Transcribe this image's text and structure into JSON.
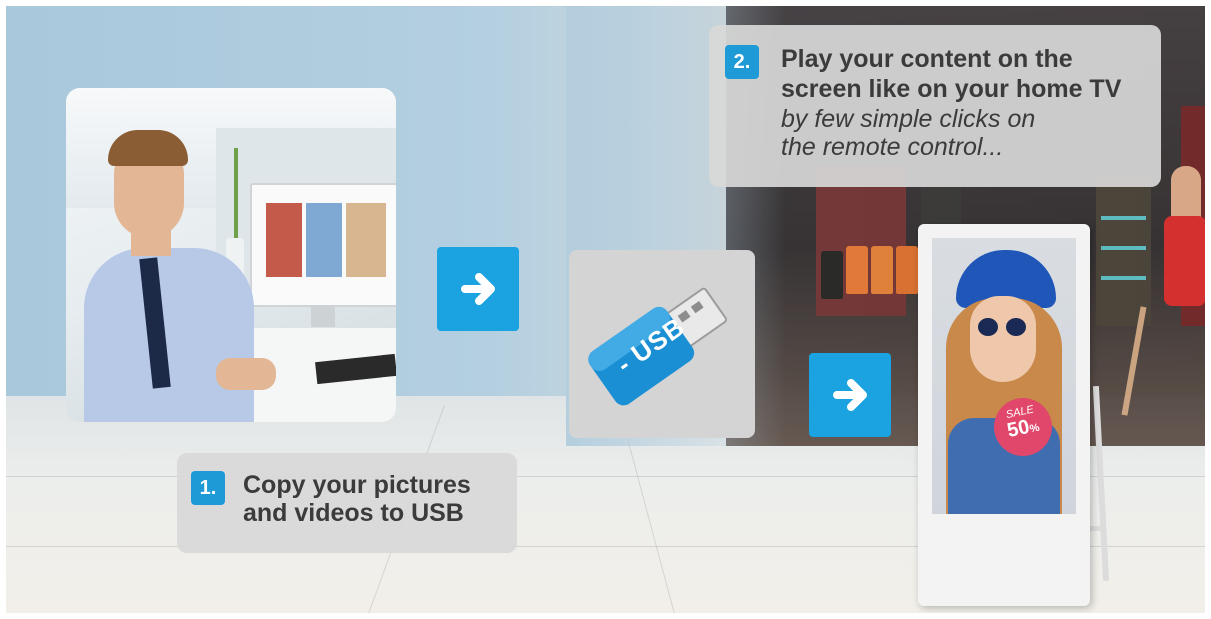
{
  "step1": {
    "number": "1.",
    "line1": "Copy your pictures",
    "line2": "and videos to USB"
  },
  "step2": {
    "number": "2.",
    "line1": "Play your content on the",
    "line2": "screen like on your home TV",
    "line3": "by few simple clicks on",
    "line4": "the remote control..."
  },
  "usb_label": "USB",
  "usb_dash": "-",
  "sale_badge": {
    "text": "SALE",
    "value": "50",
    "unit": "%"
  },
  "icons": {
    "arrow1": "arrow-right-icon",
    "arrow2": "arrow-right-icon"
  },
  "colors": {
    "accent": "#1aa3e0",
    "card": "#d8d8d8",
    "text": "#3b3b3b",
    "sale": "#e0476b"
  }
}
